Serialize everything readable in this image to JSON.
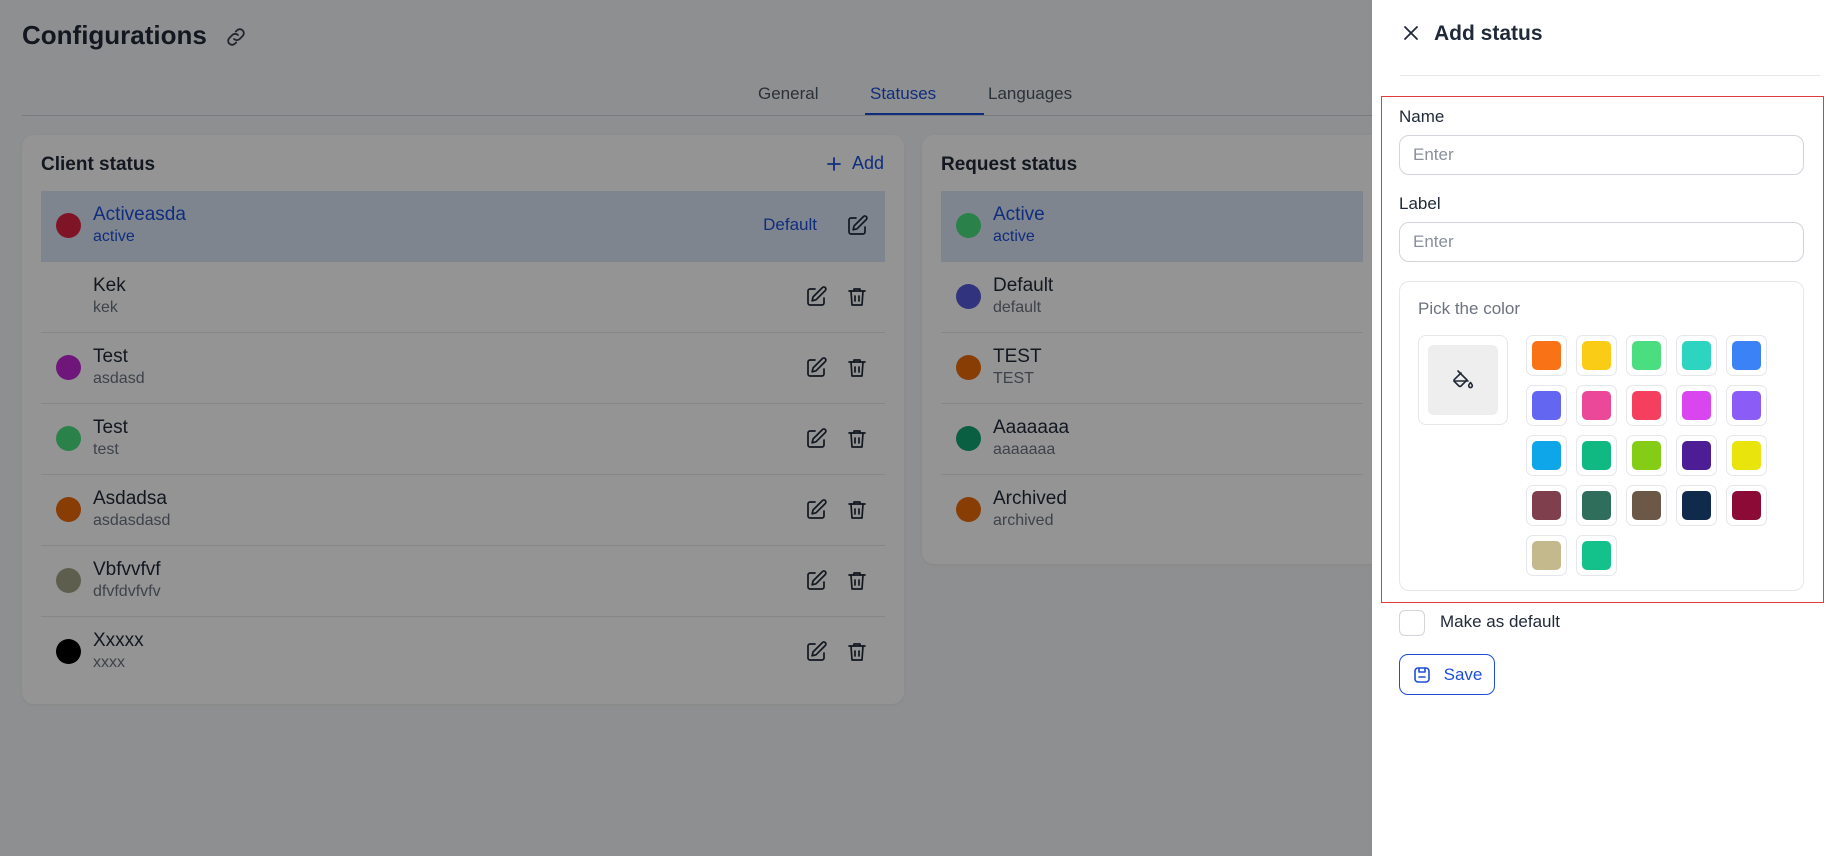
{
  "page": {
    "title": "Configurations",
    "tabs": [
      {
        "label": "General",
        "active": false
      },
      {
        "label": "Statuses",
        "active": true
      },
      {
        "label": "Languages",
        "active": false
      }
    ]
  },
  "client_status": {
    "title": "Client status",
    "add_label": "Add",
    "default_label": "Default",
    "rows": [
      {
        "name": "Activeasda",
        "label": "active",
        "color": "#dc2444",
        "is_default": true
      },
      {
        "name": "Kek",
        "label": "kek",
        "color": "",
        "is_default": false
      },
      {
        "name": "Test",
        "label": "asdasd",
        "color": "#c026d3",
        "is_default": false
      },
      {
        "name": "Test",
        "label": "test",
        "color": "#4ade80",
        "is_default": false
      },
      {
        "name": "Asdadsa",
        "label": "asdasdasd",
        "color": "#ea6a0a",
        "is_default": false
      },
      {
        "name": "Vbfvvfvf",
        "label": "dfvfdvfvfv",
        "color": "#a3a389",
        "is_default": false
      },
      {
        "name": "Xxxxx",
        "label": "xxxx",
        "color": "#000000",
        "is_default": false
      }
    ]
  },
  "request_status": {
    "title": "Request status",
    "rows": [
      {
        "name": "Active",
        "label": "active",
        "color": "#4ade80",
        "is_default": true
      },
      {
        "name": "Default",
        "label": "default",
        "color": "#5558d9",
        "is_default": false
      },
      {
        "name": "TEST",
        "label": "TEST",
        "color": "#ea6a0a",
        "is_default": false
      },
      {
        "name": "Aaaaaaa",
        "label": "aaaaaaa",
        "color": "#12a271",
        "is_default": false
      },
      {
        "name": "Archived",
        "label": "archived",
        "color": "#ea6a0a",
        "is_default": false
      }
    ]
  },
  "drawer": {
    "title": "Add status",
    "name_label": "Name",
    "name_placeholder": "Enter",
    "name_value": "",
    "label_label": "Label",
    "label_placeholder": "Enter",
    "label_value": "",
    "color_title": "Pick the color",
    "palette": [
      "#f97316",
      "#facc15",
      "#4ade80",
      "#2dd4bf",
      "#3b82f6",
      "#6366f1",
      "#ec4899",
      "#f43f5e",
      "#d946ef",
      "#8b5cf6",
      "#0ea5e9",
      "#10b981",
      "#84cc16",
      "#4c1d95",
      "#e8e40c",
      "#7f3f4d",
      "#2e6e5b",
      "#6b5847",
      "#0f2a4a",
      "#8b0a36",
      "#c4b98c",
      "#13c18a"
    ],
    "make_default_label": "Make as default",
    "make_default_checked": false,
    "save_label": "Save"
  },
  "colors": {
    "accent": "#1d4ed8",
    "highlight_frame": "#e23b3b",
    "overlay": "rgba(0,0,0,0.42)"
  }
}
